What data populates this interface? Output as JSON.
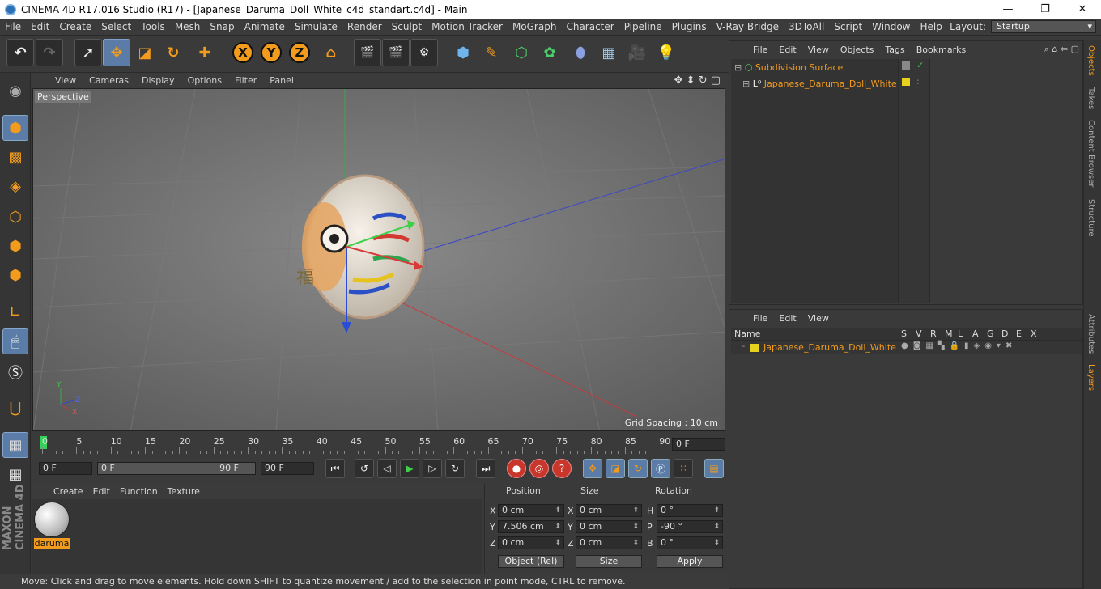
{
  "window": {
    "title": "CINEMA 4D R17.016 Studio (R17) - [Japanese_Daruma_Doll_White_c4d_standart.c4d] - Main"
  },
  "menubar": [
    "File",
    "Edit",
    "Create",
    "Select",
    "Tools",
    "Mesh",
    "Snap",
    "Animate",
    "Simulate",
    "Render",
    "Sculpt",
    "Motion Tracker",
    "MoGraph",
    "Character",
    "Pipeline",
    "Plugins",
    "V-Ray Bridge",
    "3DToAll",
    "Script",
    "Window",
    "Help"
  ],
  "layout": {
    "label": "Layout:",
    "value": "Startup"
  },
  "viewport": {
    "menu": [
      "View",
      "Cameras",
      "Display",
      "Options",
      "Filter",
      "Panel"
    ],
    "label": "Perspective",
    "grid_spacing": "Grid Spacing : 10 cm"
  },
  "timeline": {
    "ticks": [
      "0",
      "5",
      "10",
      "15",
      "20",
      "25",
      "30",
      "35",
      "40",
      "45",
      "50",
      "55",
      "60",
      "65",
      "70",
      "75",
      "80",
      "85",
      "90"
    ],
    "current_frame": "0 F"
  },
  "playback": {
    "start": "0 F",
    "range_start": "0 F",
    "range_end": "90 F",
    "end": "90 F"
  },
  "material_manager": {
    "menu": [
      "Create",
      "Edit",
      "Function",
      "Texture"
    ],
    "materials": [
      {
        "name": "daruma"
      }
    ]
  },
  "coordinates": {
    "headers": {
      "position": "Position",
      "size": "Size",
      "rotation": "Rotation"
    },
    "rows": [
      {
        "axis": "X",
        "pos": "0 cm",
        "size_axis": "X",
        "size": "0 cm",
        "rot_axis": "H",
        "rot": "0 °"
      },
      {
        "axis": "Y",
        "pos": "7.506 cm",
        "size_axis": "Y",
        "size": "0 cm",
        "rot_axis": "P",
        "rot": "-90 °"
      },
      {
        "axis": "Z",
        "pos": "0 cm",
        "size_axis": "Z",
        "size": "0 cm",
        "rot_axis": "B",
        "rot": "0 °"
      }
    ],
    "mode": "Object (Rel)",
    "size_mode": "Size",
    "apply": "Apply"
  },
  "status": "Move: Click and drag to move elements. Hold down SHIFT to quantize movement / add to the selection in point mode, CTRL to remove.",
  "object_manager": {
    "menu": [
      "File",
      "Edit",
      "View",
      "Objects",
      "Tags",
      "Bookmarks"
    ],
    "objects": [
      {
        "name": "Subdivision Surface"
      },
      {
        "name": "Japanese_Daruma_Doll_White"
      }
    ]
  },
  "layer_manager": {
    "menu": [
      "File",
      "Edit",
      "View"
    ],
    "columns": {
      "name": "Name",
      "flags": [
        "S",
        "V",
        "R",
        "M",
        "L",
        "A",
        "G",
        "D",
        "E",
        "X"
      ]
    },
    "layers": [
      {
        "name": "Japanese_Daruma_Doll_White"
      }
    ]
  },
  "right_tabs": [
    "Objects",
    "Takes",
    "Content Browser",
    "Structure",
    "Attributes",
    "Layers"
  ],
  "branding": "MAXON CINEMA 4D",
  "colors": {
    "accent": "#f29b1d",
    "selected_blue": "#5a7ca6",
    "layer_yellow": "#e6d21e"
  }
}
